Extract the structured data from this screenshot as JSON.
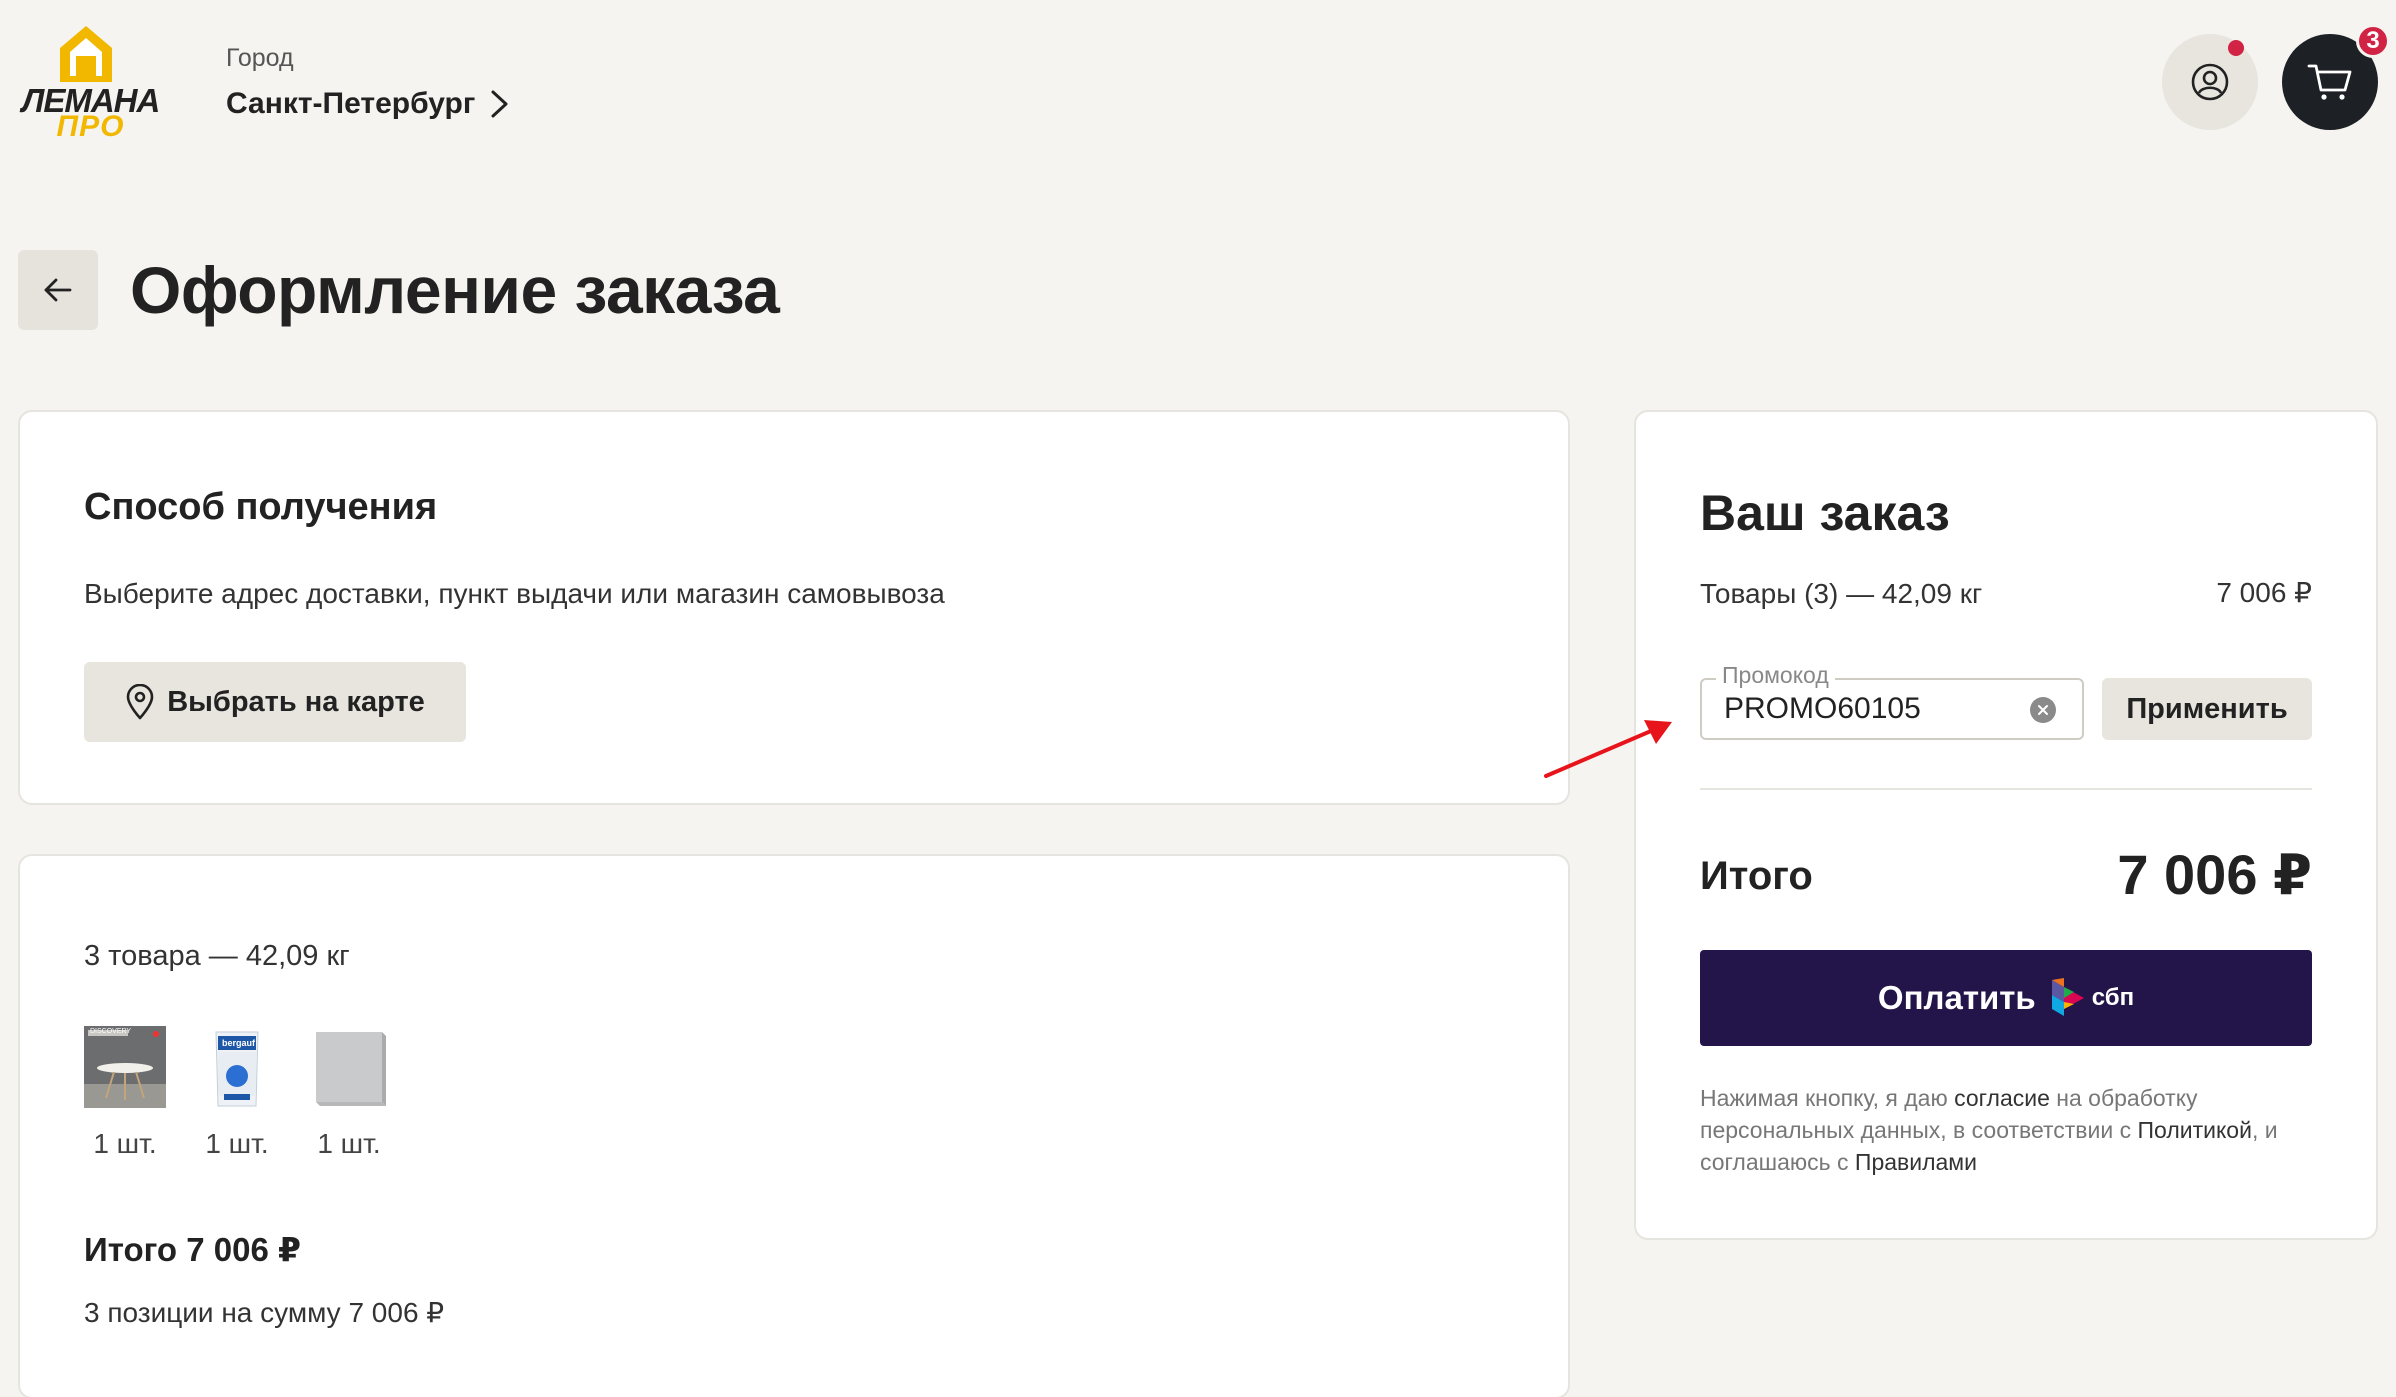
{
  "header": {
    "logo_top": "ЛЕМАНА",
    "logo_bottom": "ПРО",
    "city_label": "Город",
    "city_value": "Санкт-Петербург",
    "cart_count": "3"
  },
  "page": {
    "title": "Оформление заказа"
  },
  "delivery": {
    "title": "Способ получения",
    "description": "Выберите адрес доставки, пункт выдачи или магазин самовывоза",
    "map_button": "Выбрать на карте"
  },
  "items": {
    "summary": "3 товара — 42,09 кг",
    "list": [
      {
        "qty": "1 шт.",
        "label": "DISCOVERY"
      },
      {
        "qty": "1 шт.",
        "label": "bergauf"
      },
      {
        "qty": "1 шт.",
        "label": ""
      }
    ],
    "total": "Итого 7 006 ₽",
    "sub": "3 позиции на сумму 7 006 ₽"
  },
  "order": {
    "title": "Ваш заказ",
    "goods_label": "Товары (3) — 42,09 кг",
    "goods_sum": "7 006 ₽",
    "promo_label": "Промокод",
    "promo_value": "PROMO60105",
    "apply_button": "Применить",
    "total_label": "Итого",
    "total_value": "7 006 ₽",
    "pay_button": "Оплатить",
    "sbp_label": "сбп",
    "consent": {
      "p1": "Нажимая кнопку, я даю ",
      "link1": "согласие",
      "p2": " на обработку персональных данных, в соответствии с ",
      "link2": "Политикой",
      "p3": ", и соглашаюсь с ",
      "link3": "Правилами"
    }
  },
  "colors": {
    "background": "#f5f4f0",
    "brand_yellow": "#f2b800",
    "pay_button": "#231549",
    "badge_red": "#d12343",
    "annotation_red": "#e8141b"
  }
}
